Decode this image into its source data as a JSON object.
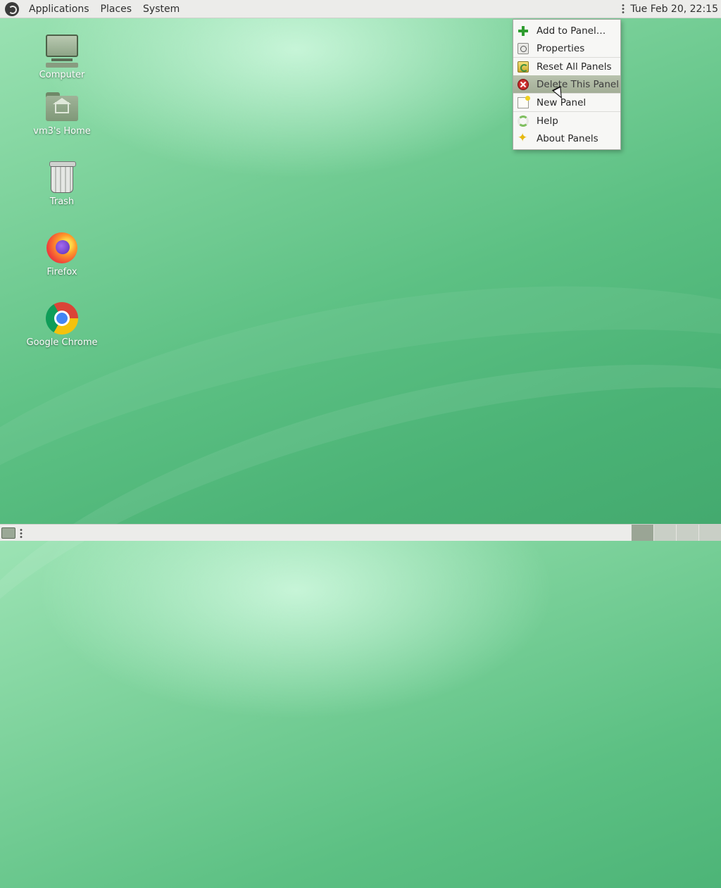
{
  "top_panel": {
    "menus": [
      {
        "label": "Applications"
      },
      {
        "label": "Places"
      },
      {
        "label": "System"
      }
    ],
    "clock": "Tue Feb 20, 22:15"
  },
  "desktop_icons": [
    {
      "label": "Computer"
    },
    {
      "label": "vm3's Home"
    },
    {
      "label": "Trash"
    },
    {
      "label": "Firefox"
    },
    {
      "label": "Google Chrome"
    }
  ],
  "context_menu": {
    "items": [
      {
        "label": "Add to Panel…",
        "icon": "plus-icon"
      },
      {
        "label": "Properties",
        "icon": "properties-icon"
      },
      {
        "label": "Reset All Panels",
        "icon": "reset-icon"
      },
      {
        "label": "Delete This Panel",
        "icon": "delete-icon",
        "highlighted": true
      },
      {
        "label": "New Panel",
        "icon": "new-panel-icon"
      },
      {
        "label": "Help",
        "icon": "help-icon"
      },
      {
        "label": "About Panels",
        "icon": "about-icon"
      }
    ]
  },
  "bottom_panel": {
    "workspaces": 4,
    "active_workspace": 1
  },
  "colors": {
    "desktop_green": "#5cc083",
    "panel_bg": "#ececea",
    "menu_highlight": "#a3ae97"
  }
}
